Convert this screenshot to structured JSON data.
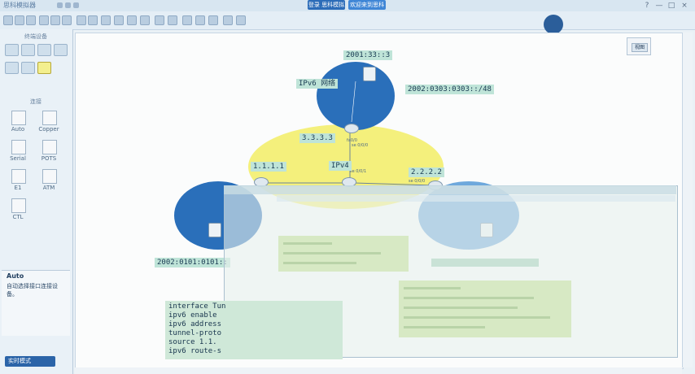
{
  "titlebar": {
    "app_name": "思科模拟器",
    "tabs": [
      "登录 思科模拟器",
      "欢迎来到思科"
    ],
    "controls": [
      "?",
      "—",
      "□",
      "×"
    ]
  },
  "left_panel": {
    "devices_title": "终端设备",
    "connections_title": "连接",
    "connections": [
      {
        "id": "auto",
        "label": "Auto",
        "icon": "lightning-icon"
      },
      {
        "id": "copper",
        "label": "Copper",
        "icon": "copper-cable-icon"
      },
      {
        "id": "serial",
        "label": "Serial",
        "icon": "serial-cable-icon"
      },
      {
        "id": "pots",
        "label": "POTS",
        "icon": "phone-line-icon"
      },
      {
        "id": "e1",
        "label": "E1",
        "icon": "e1-cable-icon"
      },
      {
        "id": "atm",
        "label": "ATM",
        "icon": "atm-cable-icon"
      },
      {
        "id": "ctl",
        "label": "CTL",
        "icon": "console-cable-icon"
      }
    ],
    "description": {
      "title": "Auto",
      "text": "自动选择接口连接设备。"
    },
    "realtime_label": "实时模式"
  },
  "topology": {
    "labels": {
      "top_addr": "2001:33::3",
      "ipv6_net": "IPv6 网络",
      "top_right_addr": "2002:0303:0303::/48",
      "r3_addr": "3.3.3.3",
      "ipv4": "IPv4",
      "r1_addr": "1.1.1.1",
      "r2_addr": "2.2.2.2",
      "left_addr": "2002:0101:0101::"
    },
    "ports": {
      "p_top": "fa0/0",
      "p_r3_down": "se 0/0/0",
      "p_center": "se 0/0/1",
      "p_right": "se 0/0/0"
    },
    "colors": {
      "ipv6_cloud": "#2a6fba",
      "ipv4_cloud": "#f4f07c",
      "label_bg": "#bfe4d8"
    }
  },
  "cli": {
    "lines": [
      "interface Tun",
      " ipv6 enable",
      " ipv6 address",
      " tunnel-proto",
      " source 1.1.",
      " ipv6 route-s"
    ]
  },
  "minimap": {
    "button": "视图"
  }
}
